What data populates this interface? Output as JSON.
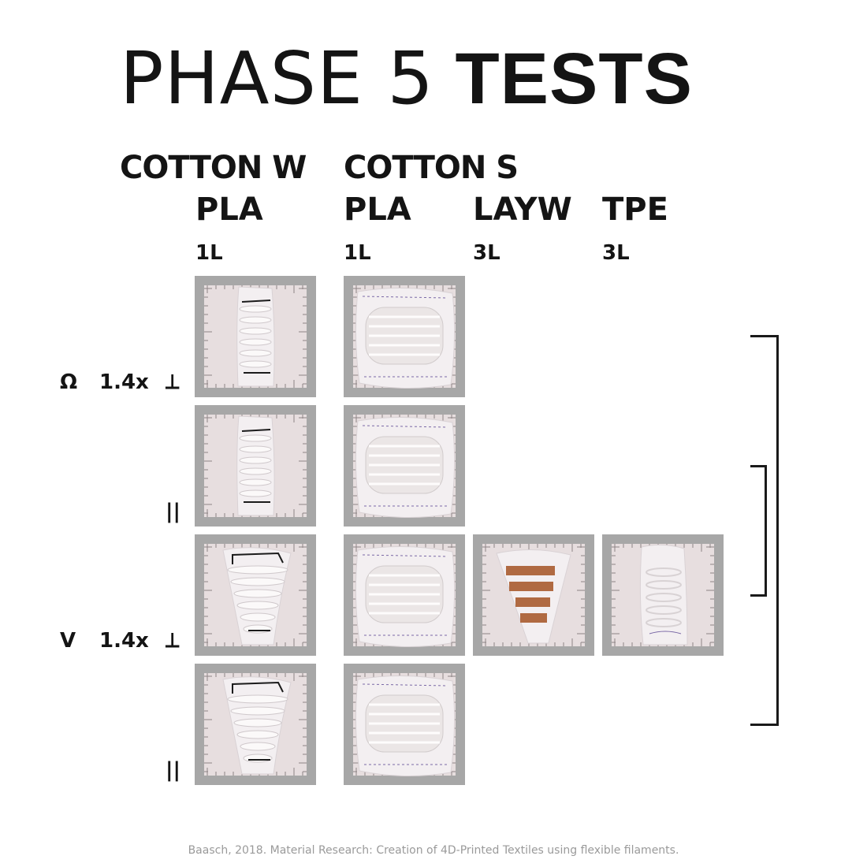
{
  "header": {
    "title_light": "PHASE 5",
    "title_bold": "TESTS"
  },
  "columns": {
    "fabric_w": "COTTON W",
    "fabric_s": "COTTON S",
    "mat_1": "PLA",
    "mat_2": "PLA",
    "mat_3": "LAYW",
    "mat_4": "TPE",
    "layer_1": "1L",
    "layer_2": "1L",
    "layer_3": "3L",
    "layer_4": "3L"
  },
  "rows": {
    "omega_symbol": "Ω",
    "omega_scale": "1.4x",
    "omega_perp": "⟂",
    "omega_parallel": "||",
    "v_symbol": "V",
    "v_scale": "1.4x",
    "v_perp": "⟂",
    "v_parallel": "||"
  },
  "colors": {
    "tile_frame": "#a7a7a7",
    "tile_board": "#e7dedf",
    "fabric": "#f3eff1",
    "pla_stripe": "#fbf9f9",
    "layw_stripe": "#b06a42",
    "ink_marker": "#1b1b1b",
    "ink_pen": "#7b69a6"
  },
  "footer": {
    "credit": "Baasch, 2018. Material Research: Creation of 4D-Printed Textiles using flexible filaments."
  }
}
